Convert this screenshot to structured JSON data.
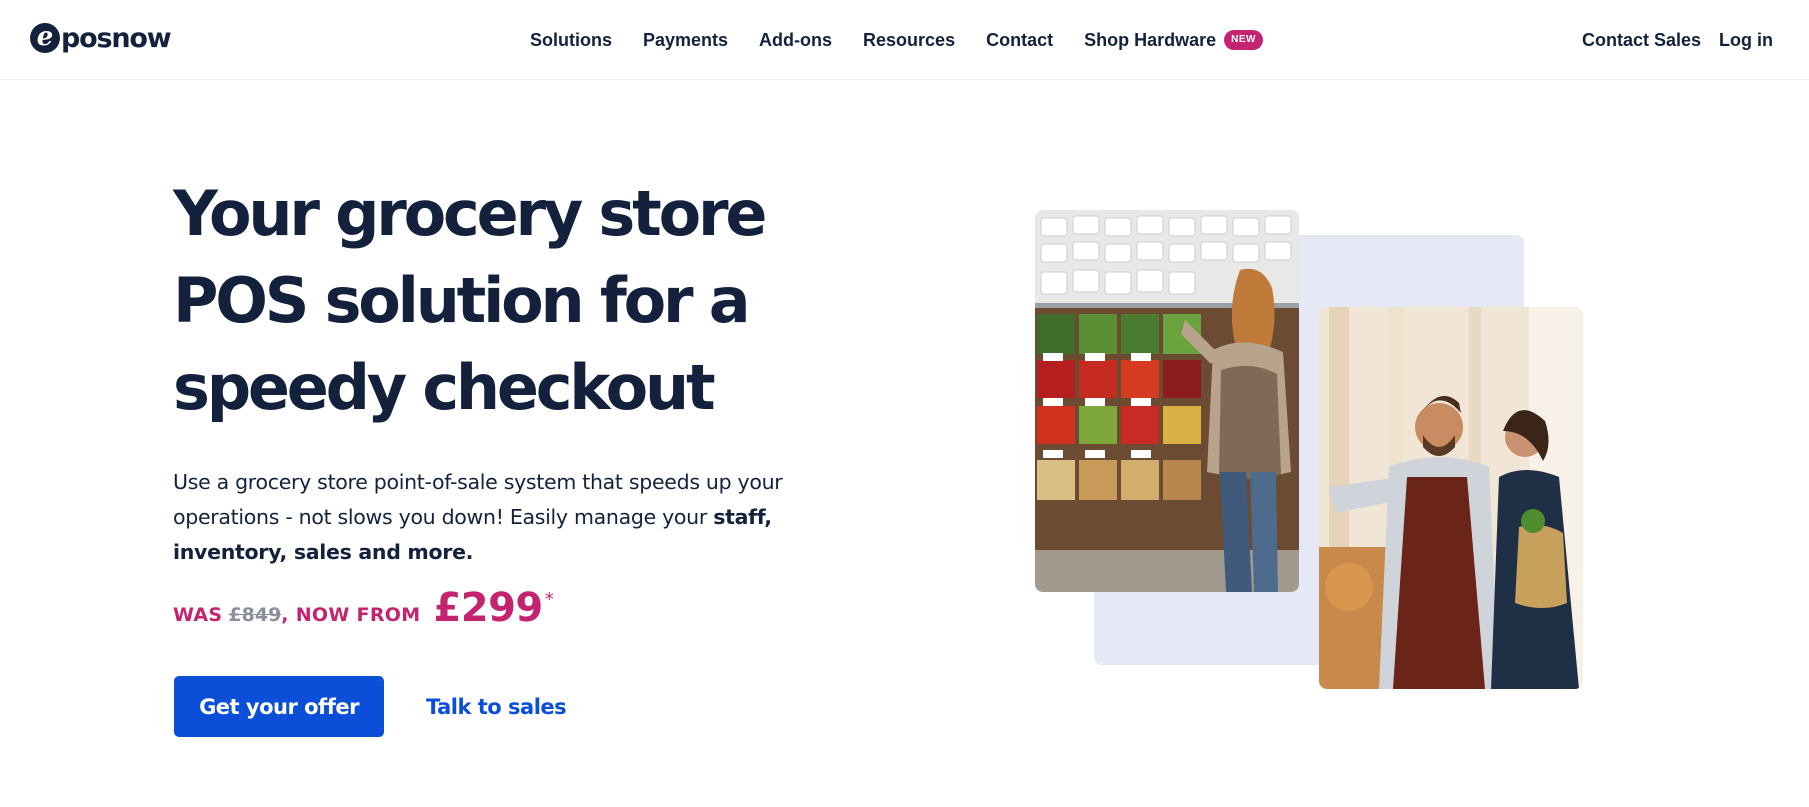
{
  "brand": {
    "logo_mark": "e",
    "logo_text": "posnow"
  },
  "nav": {
    "items": [
      "Solutions",
      "Payments",
      "Add-ons",
      "Resources",
      "Contact",
      "Shop Hardware"
    ],
    "new_badge": "NEW",
    "contact_sales": "Contact Sales",
    "login": "Log in"
  },
  "hero": {
    "headline_lines": [
      "Your grocery store",
      "POS solution for a",
      "speedy checkout"
    ],
    "description_plain": "Use a grocery store point-of-sale system that speeds up your operations - not slows you down! Easily manage your ",
    "description_bold": "staff, inventory, sales and more.",
    "price_was_label": "WAS ",
    "price_old": "£849",
    "price_now_label": ", NOW FROM",
    "price_new": "£299",
    "price_asterisk": "*",
    "cta_primary": "Get your offer",
    "cta_secondary": "Talk to sales"
  },
  "colors": {
    "navy": "#14213d",
    "brand_blue": "#0b4fd9",
    "magenta": "#c4246f",
    "panel_bg": "#e4e9f5"
  },
  "icons": {
    "logo": "eposnow-e-mark"
  }
}
